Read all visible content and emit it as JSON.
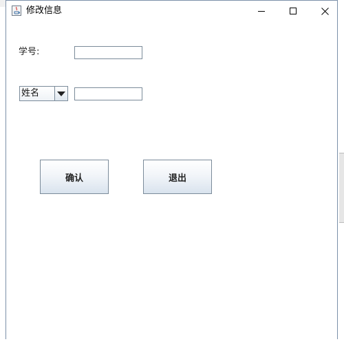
{
  "window": {
    "title": "修改信息",
    "controls": {
      "minimize_icon": "minimize-icon",
      "maximize_icon": "maximize-icon",
      "close_icon": "close-icon"
    }
  },
  "form": {
    "student_id_label": "学号:",
    "student_id_value": "",
    "field_selector": {
      "selected": "姓名",
      "options": [
        "姓名"
      ]
    },
    "field_value": ""
  },
  "buttons": {
    "confirm_label": "确认",
    "exit_label": "退出"
  },
  "colors": {
    "border": "#7a8a99",
    "button_gradient_bottom": "#d9e3ee",
    "window_border": "#7a8fa8"
  }
}
